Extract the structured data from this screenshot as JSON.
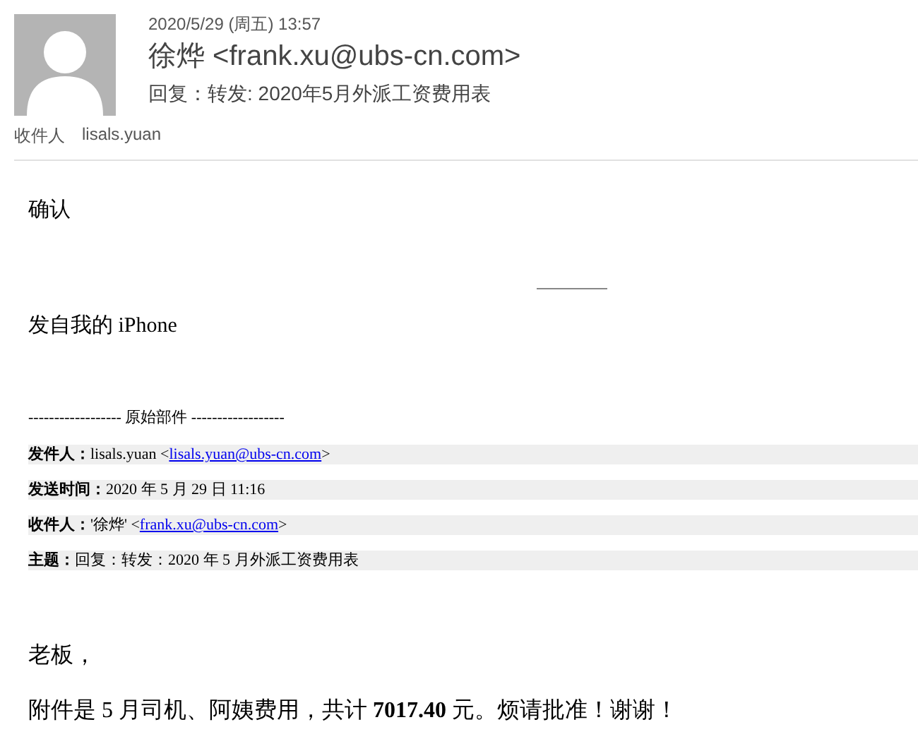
{
  "header": {
    "date": "2020/5/29 (周五) 13:57",
    "sender": "徐烨 <frank.xu@ubs-cn.com>",
    "subject": "回复：转发: 2020年5月外派工资费用表",
    "to_label": "收件人",
    "to": "lisals.yuan"
  },
  "body": {
    "reply": "确认",
    "signature": "发自我的 iPhone",
    "divider": "------------------ 原始部件 ------------------",
    "fields": [
      {
        "label": "发件人：",
        "text": "lisals.yuan <",
        "link": "lisals.yuan@ubs-cn.com",
        "after": ">"
      },
      {
        "label": "发送时间：",
        "text": "2020 年 5 月 29 日 11:16"
      },
      {
        "label": "收件人：",
        "text": "'徐烨' <",
        "link": "frank.xu@ubs-cn.com",
        "after": ">"
      },
      {
        "label": "主题：",
        "text": "回复：转发：2020 年 5 月外派工资费用表"
      }
    ],
    "greeting": "老板，",
    "message": "附件是 5 月司机、阿姨费用，共计 **7017.40** 元。烦请批准！谢谢！"
  }
}
